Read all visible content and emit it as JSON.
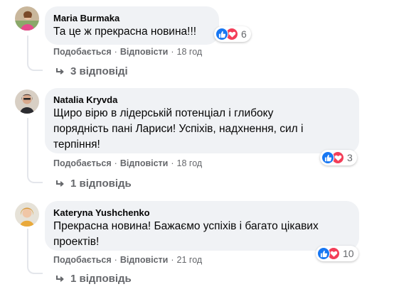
{
  "comments": [
    {
      "author": "Maria Burmaka",
      "text_lines": [
        "Та це ж прекрасна новина!!!"
      ],
      "reaction_count": "6",
      "like_label": "Подобається",
      "reply_label": "Відповісти",
      "time": "18 год",
      "replies_label": "3 відповіді"
    },
    {
      "author": "Natalia Kryvda",
      "text_lines": [
        "Щиро вірю в лідерській потенціал і глибоку",
        "порядність пані Лариси! Успіхів, надхнення, сил і",
        "терпіння!"
      ],
      "reaction_count": "3",
      "like_label": "Подобається",
      "reply_label": "Відповісти",
      "time": "18 год",
      "replies_label": "1 відповідь"
    },
    {
      "author": "Kateryna Yushchenko",
      "text_lines": [
        "Прекрасна новина! Бажаємо успіхів і багато цікавих",
        "проектів!"
      ],
      "reaction_count": "10",
      "like_label": "Подобається",
      "reply_label": "Відповісти",
      "time": "21 год",
      "replies_label": "1 відповідь"
    }
  ],
  "colors": {
    "bubble": "#f0f2f5",
    "meta_text": "#65676b",
    "like_blue": "#1877f2",
    "love_red": "#f33e58"
  },
  "icons": {
    "like": "thumbs-up-icon",
    "love": "heart-icon",
    "reply": "reply-arrow-icon"
  }
}
